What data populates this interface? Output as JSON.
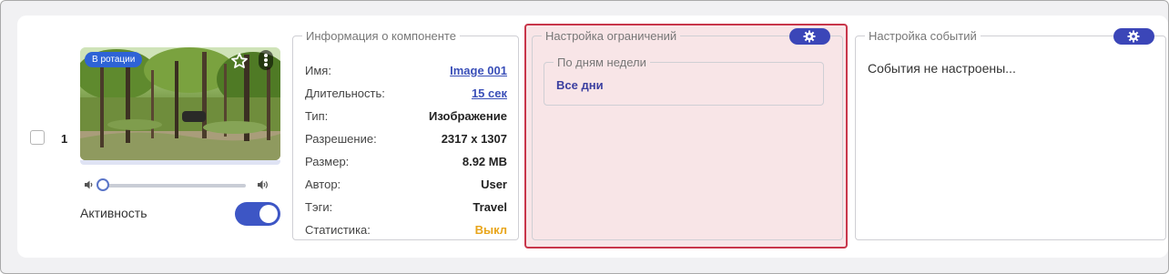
{
  "row": {
    "index": "1",
    "selected": false
  },
  "thumbnail": {
    "badge": "В ротации",
    "star_icon": "star-outline-icon",
    "menu_icon": "kebab-menu-icon"
  },
  "volume": {
    "level": 0,
    "low_icon": "volume-low-icon",
    "high_icon": "volume-high-icon"
  },
  "activity": {
    "label": "Активность",
    "enabled": true
  },
  "info": {
    "title": "Информация о компоненте",
    "rows": [
      {
        "key": "Имя:",
        "value": "Image 001"
      },
      {
        "key": "Длительность:",
        "value": "15 сек"
      },
      {
        "key": "Тип:",
        "value": "Изображение"
      },
      {
        "key": "Разрешение:",
        "value": "2317 x 1307"
      },
      {
        "key": "Размер:",
        "value": "8.92 MB"
      },
      {
        "key": "Автор:",
        "value": "User"
      },
      {
        "key": "Тэги:",
        "value": "Travel"
      },
      {
        "key": "Статистика:",
        "value": "Выкл"
      }
    ]
  },
  "limits": {
    "title": "Настройка ограничений",
    "settings_icon": "gear-icon",
    "days": {
      "title": "По дням недели",
      "value": "Все дни"
    }
  },
  "events": {
    "title": "Настройка событий",
    "settings_icon": "gear-icon",
    "message": "События не настроены..."
  },
  "colors": {
    "accent": "#3b46b8",
    "toggle": "#3d56c5",
    "highlight_border": "#c8364a",
    "highlight_bg": "#f8e5e7",
    "status_off": "#e8a51b"
  }
}
